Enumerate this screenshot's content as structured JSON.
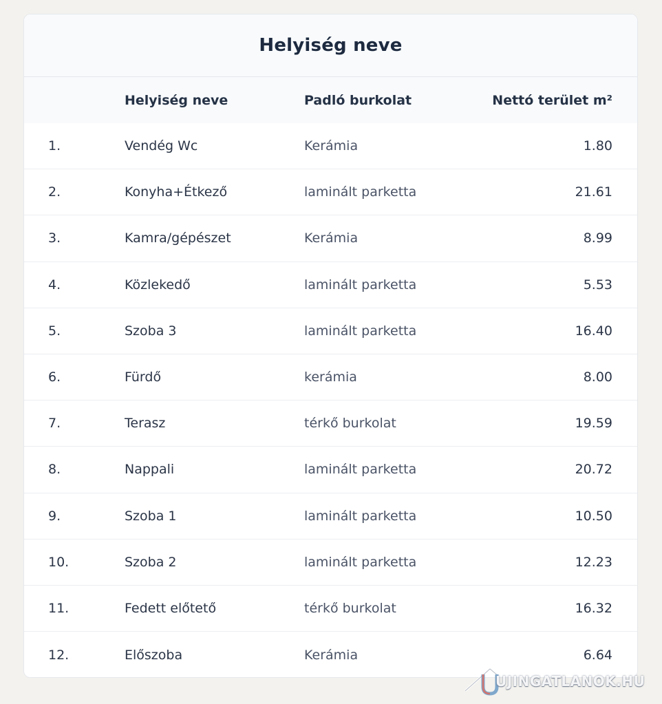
{
  "card": {
    "title": "Helyiség neve"
  },
  "table": {
    "headers": {
      "num": "",
      "name": "Helyiség neve",
      "floor": "Padló burkolat",
      "area": "Nettó terület m²"
    },
    "rows": [
      {
        "num": "1.",
        "name": "Vendég Wc",
        "floor": "Kerámia",
        "area": "1.80"
      },
      {
        "num": "2.",
        "name": "Konyha+Étkező",
        "floor": "laminált parketta",
        "area": "21.61"
      },
      {
        "num": "3.",
        "name": "Kamra/gépészet",
        "floor": "Kerámia",
        "area": "8.99"
      },
      {
        "num": "4.",
        "name": "Közlekedő",
        "floor": "laminált parketta",
        "area": "5.53"
      },
      {
        "num": "5.",
        "name": "Szoba 3",
        "floor": "laminált parketta",
        "area": "16.40"
      },
      {
        "num": "6.",
        "name": "Fürdő",
        "floor": "kerámia",
        "area": "8.00"
      },
      {
        "num": "7.",
        "name": "Terasz",
        "floor": "térkő burkolat",
        "area": "19.59"
      },
      {
        "num": "8.",
        "name": "Nappali",
        "floor": "laminált parketta",
        "area": "20.72"
      },
      {
        "num": "9.",
        "name": "Szoba 1",
        "floor": "laminált parketta",
        "area": "10.50"
      },
      {
        "num": "10.",
        "name": "Szoba 2",
        "floor": "laminált parketta",
        "area": "12.23"
      },
      {
        "num": "11.",
        "name": "Fedett előtető",
        "floor": "térkő burkolat",
        "area": "16.32"
      },
      {
        "num": "12.",
        "name": "Előszoba",
        "floor": "Kerámia",
        "area": "6.64"
      }
    ]
  },
  "watermark": {
    "text": "UJINGATLANOK.HU",
    "icon": "house-logo-icon"
  },
  "colors": {
    "title": "#1d2a3f",
    "header_bg": "#f8fafc",
    "page_bg": "#f3f2ee"
  }
}
